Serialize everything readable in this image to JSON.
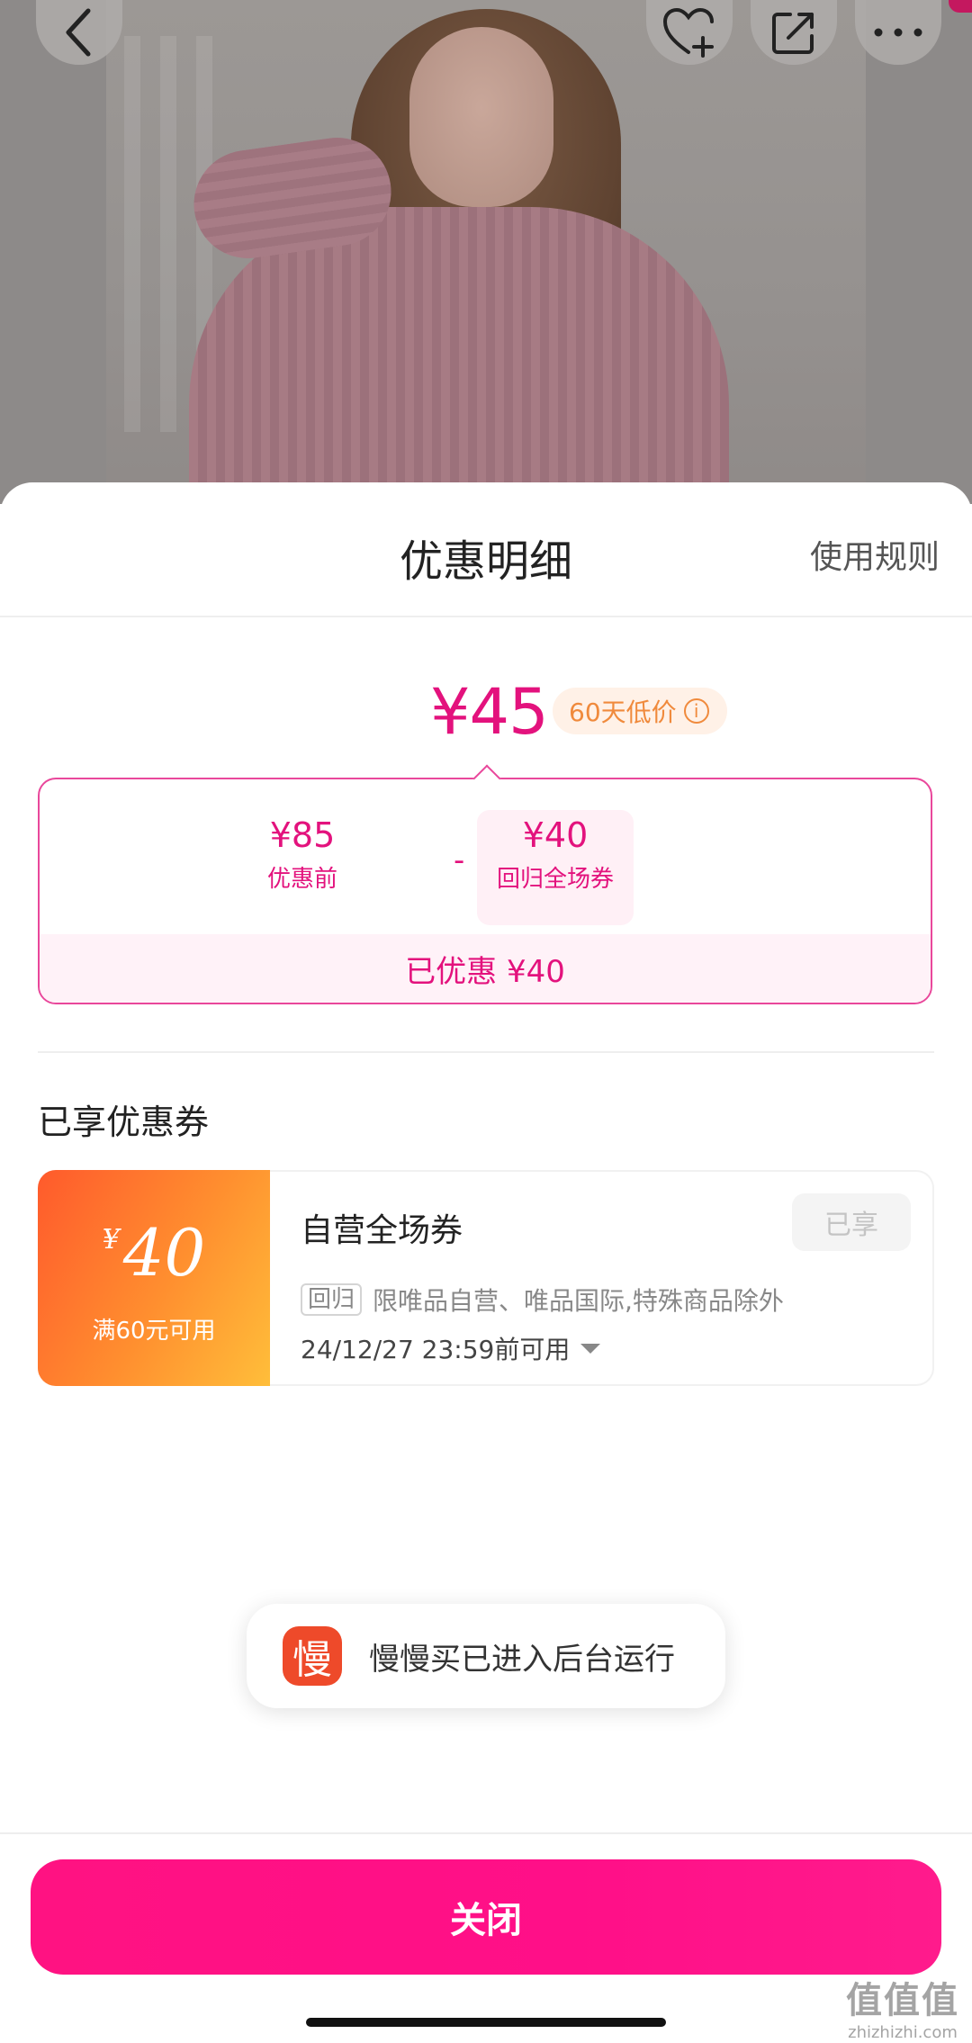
{
  "sheet": {
    "title": "优惠明细",
    "rules_link": "使用规则"
  },
  "price": {
    "final": "¥45",
    "badge": "60天低价",
    "badge_icon": "i"
  },
  "breakdown": {
    "original_value": "¥85",
    "original_label": "优惠前",
    "minus": "-",
    "discount_value": "¥40",
    "discount_label": "回归全场券",
    "saved_text": "已优惠 ¥40"
  },
  "coupons_section": {
    "title": "已享优惠券",
    "coupon": {
      "currency": "¥",
      "amount": "40",
      "condition": "满60元可用",
      "name": "自营全场券",
      "status": "已享",
      "tag": "回归",
      "description": "限唯品自营、唯品国际,特殊商品除外",
      "expiry": "24/12/27 23:59前可用"
    }
  },
  "toast": {
    "icon_char": "慢",
    "text": "慢慢买已进入后台运行"
  },
  "close_button": "关闭",
  "watermark": {
    "main": "值值值",
    "url": "zhizhizhi.com"
  },
  "colors": {
    "accent": "#e3127d",
    "button": "#ff1282",
    "badge_orange": "#f08a3c",
    "toast_icon": "#ee4a2a"
  }
}
